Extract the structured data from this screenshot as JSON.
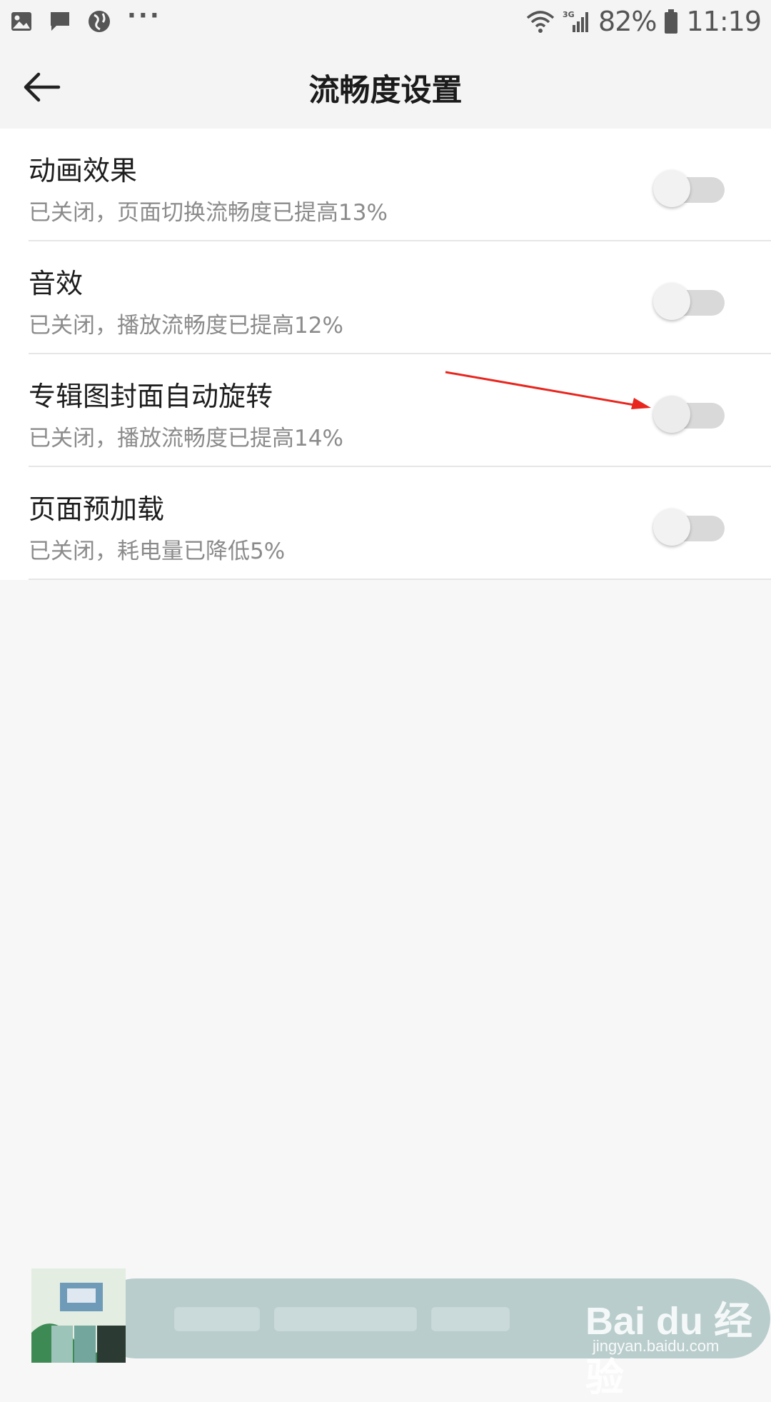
{
  "status_bar": {
    "battery": "82%",
    "time": "11:19",
    "network": "3G",
    "left_icons": [
      "gallery-icon",
      "message-icon",
      "globe-icon",
      "more-dots-icon"
    ],
    "right_icons": [
      "wifi-icon",
      "signal-icon",
      "battery-icon"
    ]
  },
  "header": {
    "title": "流畅度设置",
    "back_icon": "arrow-left-icon"
  },
  "settings": [
    {
      "title": "动画效果",
      "subtitle": "已关闭，页面切换流畅度已提高13%",
      "enabled": false
    },
    {
      "title": "音效",
      "subtitle": "已关闭，播放流畅度已提高12%",
      "enabled": false
    },
    {
      "title": "专辑图封面自动旋转",
      "subtitle": "已关闭，播放流畅度已提高14%",
      "enabled": false
    },
    {
      "title": "页面预加载",
      "subtitle": "已关闭，耗电量已降低5%",
      "enabled": false
    }
  ],
  "watermark": {
    "brand": "Bai du 经验",
    "url": "jingyan.baidu.com"
  },
  "colors": {
    "background": "#f7f7f7",
    "list_background": "#ffffff",
    "toggle_off_track": "#d9d9d9",
    "annotation_arrow": "#e8261e",
    "player_bar": "#b9cdcc"
  }
}
